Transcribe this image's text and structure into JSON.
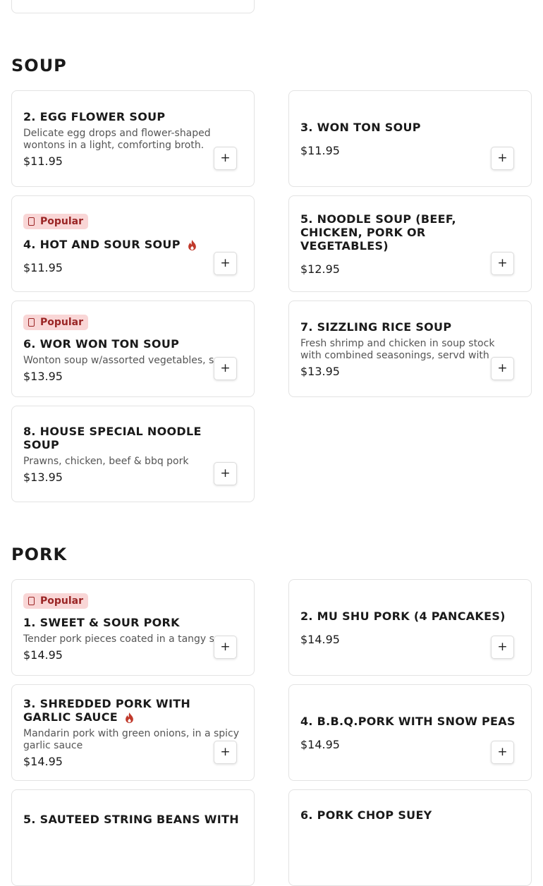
{
  "sections": {
    "soup": {
      "title": "SOUP",
      "items": [
        {
          "name": "2. EGG FLOWER SOUP",
          "desc": "Delicate egg drops and flower-shaped wontons in a light, comforting broth.",
          "price": "$11.95"
        },
        {
          "name": "3. WON TON SOUP",
          "price": "$11.95"
        },
        {
          "badge": "Popular",
          "name": "4. HOT AND SOUR SOUP",
          "spicy": true,
          "price": "$11.95"
        },
        {
          "name": "5. NOODLE SOUP (BEEF, CHICKEN, PORK OR VEGETABLES)",
          "price": "$12.95"
        },
        {
          "badge": "Popular",
          "name": "6. WOR WON TON SOUP",
          "desc": "Wonton soup w/assorted vegetables, s...",
          "price": "$13.95"
        },
        {
          "name": "7. SIZZLING RICE SOUP",
          "desc": "Fresh shrimp and chicken in soup stock with combined seasonings, servd with sizzling...",
          "price": "$13.95"
        },
        {
          "name": "8. HOUSE SPECIAL NOODLE SOUP",
          "desc": "Prawns, chicken, beef & bbq pork",
          "price": "$13.95"
        }
      ]
    },
    "pork": {
      "title": "PORK",
      "items": [
        {
          "badge": "Popular",
          "name": "1. SWEET & SOUR PORK",
          "desc": "Tender pork pieces coated in a tangy s...",
          "price": "$14.95"
        },
        {
          "name": "2. MU SHU PORK (4 PANCAKES)",
          "price": "$14.95"
        },
        {
          "name": "3. SHREDDED PORK WITH GARLIC SAUCE",
          "spicy": true,
          "desc": "Mandarin pork with green onions, in a spicy garlic sauce",
          "price": "$14.95"
        },
        {
          "name": "4. B.B.Q.PORK WITH SNOW PEAS",
          "price": "$14.95"
        },
        {
          "name": "5. SAUTEED STRING BEANS WITH"
        },
        {
          "name": "6. PORK CHOP SUEY"
        }
      ]
    }
  },
  "add_button_label": "+",
  "colors": {
    "badge_bg": "#f9d6d6",
    "badge_text": "#9a2525",
    "flame": "#c0392b",
    "border": "#e3e3e3"
  },
  "icons": {
    "badge": "popular-icon",
    "spicy": "flame-icon",
    "add": "plus-icon"
  }
}
